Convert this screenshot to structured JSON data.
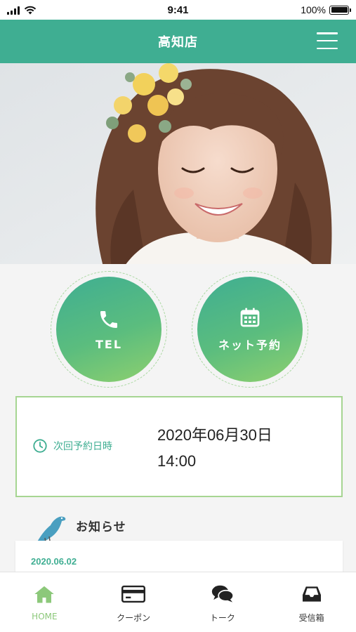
{
  "status_bar": {
    "time": "9:41",
    "battery": "100%"
  },
  "header": {
    "title": "高知店",
    "menu_icon": "hamburger-menu-icon"
  },
  "actions": {
    "tel": {
      "label": "TEL",
      "icon": "phone-icon"
    },
    "booking": {
      "label": "ネット予約",
      "icon": "calendar-icon"
    }
  },
  "reservation": {
    "label": "次回予約日時",
    "icon": "clock-icon",
    "date": "2020年06月30日",
    "time": "14:00"
  },
  "news": {
    "heading": "お知らせ",
    "icon": "bird-icon",
    "items": [
      {
        "date": "2020.06.02"
      }
    ]
  },
  "tabs": [
    {
      "label": "HOME",
      "icon": "home-icon",
      "active": true
    },
    {
      "label": "クーポン",
      "icon": "coupon-card-icon",
      "active": false
    },
    {
      "label": "トーク",
      "icon": "chat-bubbles-icon",
      "active": false
    },
    {
      "label": "受信箱",
      "icon": "inbox-icon",
      "active": false
    }
  ],
  "colors": {
    "primary": "#3fae92",
    "accent_light": "#8cc87a",
    "border_green": "#a6d592",
    "background": "#f4f4f4"
  }
}
